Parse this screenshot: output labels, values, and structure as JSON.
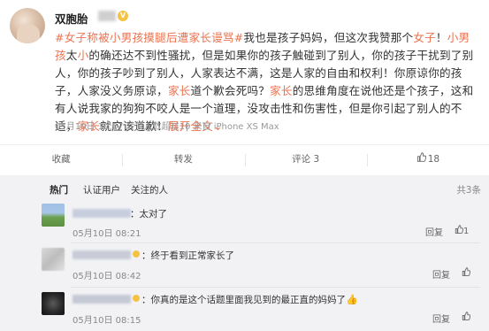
{
  "post": {
    "username": "双胞胎",
    "content": [
      {
        "t": "#女子称被小男孩摸腿后遭家长谩骂#",
        "hl": true
      },
      {
        "t": "我也是孩子妈妈，但这次我赞那个",
        "hl": false
      },
      {
        "t": "女子",
        "hl": true
      },
      {
        "t": "！",
        "hl": false
      },
      {
        "t": "小男孩",
        "hl": true
      },
      {
        "t": "太",
        "hl": false
      },
      {
        "t": "小",
        "hl": true
      },
      {
        "t": "的确还达不到性骚扰，但是如果你的孩子触碰到了别人，你的孩子干扰到了别人，你的孩子吵到了别人，人家表达不满，这是人家的自由和权利！你原谅你的孩子，人家没义务原谅，",
        "hl": false
      },
      {
        "t": "家长",
        "hl": true
      },
      {
        "t": "道个歉会死吗？",
        "hl": false
      },
      {
        "t": "家长",
        "hl": true
      },
      {
        "t": "的思维角度在说他还是个孩子，这和有人说我家的狗狗不咬人是一个道理，没攻击性和伤害性，但是你引起了别人的不适，",
        "hl": false
      },
      {
        "t": "家长",
        "hl": true
      },
      {
        "t": "就应该道歉！",
        "hl": false
      }
    ],
    "show_more": "展开全文",
    "show_more_arrow": "⌄",
    "meta": "05月10日 19:27 转赞人数超过10  来自 iPhone XS Max"
  },
  "actions": {
    "favorite": "收藏",
    "repost": "转发",
    "comment": "评论 3",
    "like_icon": "thumbs-up-icon",
    "like_count": "18"
  },
  "comments_section": {
    "tabs": [
      "热门",
      "认证用户",
      "关注的人"
    ],
    "total": "共3条",
    "items": [
      {
        "text": "：太对了",
        "time": "05月10日 08:21",
        "reply": "回复",
        "like": "1"
      },
      {
        "text": "：终于看到正常家长了",
        "time": "05月10日 08:42",
        "reply": "回复",
        "like": ""
      },
      {
        "text": "：你真的是这个话题里面我见到的最正直的妈妈了",
        "time": "05月10日 08:15",
        "reply": "回复",
        "like": ""
      }
    ]
  },
  "colors": {
    "accent": "#eb7350",
    "badge": "#f6c244",
    "comments_bg": "#f2f2f5"
  }
}
